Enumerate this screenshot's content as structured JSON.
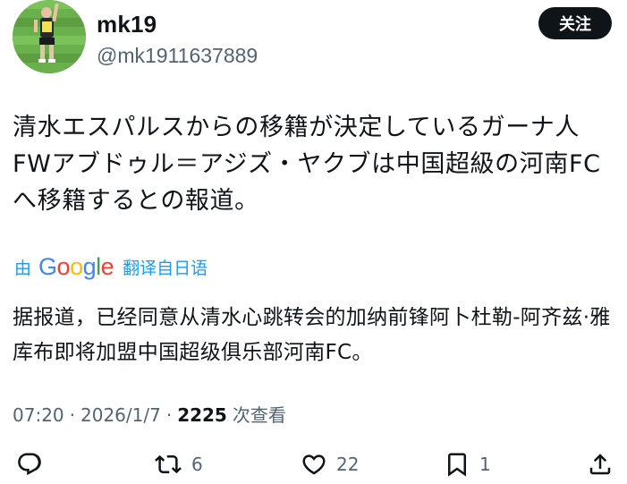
{
  "author": {
    "display_name": "mk19",
    "handle": "@mk1911637889",
    "avatar": "soccer-player-avatar"
  },
  "follow_button": {
    "label": "关注"
  },
  "tweet": {
    "text": "清水エスパルスからの移籍が決定しているガーナ人FWアブドゥル＝アジズ・ヤクブは中国超級の河南FCへ移籍するとの報道。"
  },
  "translate": {
    "prefix": "由",
    "provider": "Google",
    "action": "翻译自日语"
  },
  "translation": {
    "text": "据报道，已经同意从清水心跳转会的加纳前锋阿卜杜勒-阿齐兹·雅库布即将加盟中国超级俱乐部河南FC。"
  },
  "meta": {
    "time": "07:20",
    "date": "2026/1/7",
    "separator": "·",
    "views_count": "2225",
    "views_label": "次查看"
  },
  "actions": {
    "reply": {
      "icon": "reply-icon",
      "count": ""
    },
    "retweet": {
      "icon": "retweet-icon",
      "count": "6"
    },
    "like": {
      "icon": "heart-icon",
      "count": "22"
    },
    "bookmark": {
      "icon": "bookmark-icon",
      "count": "1"
    },
    "share": {
      "icon": "share-icon",
      "count": ""
    }
  },
  "colors": {
    "text": "#0f1419",
    "secondary": "#536471",
    "link": "#1d9bf0",
    "button_bg": "#0f1419"
  }
}
